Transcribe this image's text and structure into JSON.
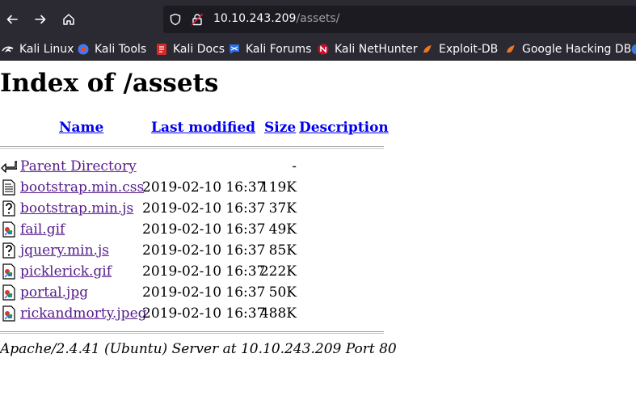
{
  "browser": {
    "url_host": "10.10.243.209",
    "url_path": "/assets/",
    "bookmarks": [
      {
        "label": "Kali Linux",
        "icon": "kali-dragon-icon"
      },
      {
        "label": "Kali Tools",
        "icon": "kali-tools-icon"
      },
      {
        "label": "Kali Docs",
        "icon": "kali-docs-icon"
      },
      {
        "label": "Kali Forums",
        "icon": "kali-forums-icon"
      },
      {
        "label": "Kali NetHunter",
        "icon": "kali-nethunter-icon"
      },
      {
        "label": "Exploit-DB",
        "icon": "exploit-db-icon"
      },
      {
        "label": "Google Hacking DB",
        "icon": "ghdb-icon"
      }
    ]
  },
  "page": {
    "title": "Index of /assets",
    "columns": {
      "name": "Name",
      "last_modified": "Last modified",
      "size": "Size",
      "description": "Description"
    },
    "parent": {
      "name": "Parent Directory",
      "size": "-"
    },
    "files": [
      {
        "name": "bootstrap.min.css",
        "modified": "2019-02-10 16:37",
        "size": "119K",
        "icon": "text-file-icon"
      },
      {
        "name": "bootstrap.min.js",
        "modified": "2019-02-10 16:37",
        "size": "37K",
        "icon": "unknown-file-icon"
      },
      {
        "name": "fail.gif",
        "modified": "2019-02-10 16:37",
        "size": "49K",
        "icon": "image-file-icon"
      },
      {
        "name": "jquery.min.js",
        "modified": "2019-02-10 16:37",
        "size": "85K",
        "icon": "unknown-file-icon"
      },
      {
        "name": "picklerick.gif",
        "modified": "2019-02-10 16:37",
        "size": "222K",
        "icon": "image-file-icon"
      },
      {
        "name": "portal.jpg",
        "modified": "2019-02-10 16:37",
        "size": "50K",
        "icon": "image-file-icon"
      },
      {
        "name": "rickandmorty.jpeg",
        "modified": "2019-02-10 16:37",
        "size": "488K",
        "icon": "image-file-icon"
      }
    ],
    "footer": "Apache/2.4.41 (Ubuntu) Server at 10.10.243.209 Port 80"
  }
}
